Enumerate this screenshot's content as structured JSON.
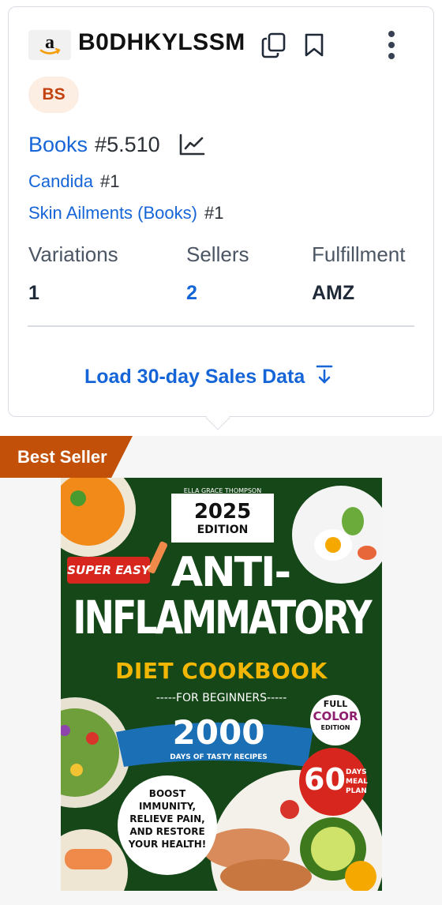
{
  "header": {
    "logo_icon": "amazon-logo-icon",
    "asin": "B0DHKYLSSM",
    "actions": [
      "copy-icon",
      "bookmark-icon",
      "more-vertical-icon"
    ]
  },
  "badge": {
    "label": "BS"
  },
  "rank": {
    "main": {
      "category": "Books",
      "rank": "#5.510",
      "icon": "line-chart-icon"
    },
    "sub": [
      {
        "category": "Candida",
        "rank": "#1"
      },
      {
        "category": "Skin Ailments (Books)",
        "rank": "#1"
      }
    ]
  },
  "stats": [
    {
      "label": "Variations",
      "value": "1"
    },
    {
      "label": "Sellers",
      "value": "2"
    },
    {
      "label": "Fulfillment",
      "value": "AMZ"
    }
  ],
  "load_sales": {
    "label": "Load 30-day Sales Data",
    "icon": "arrow-down-to-line-icon"
  },
  "product": {
    "ribbon": "Best Seller",
    "cover": {
      "author": "ELLA GRACE THOMPSON",
      "year": "2025",
      "edition": "EDITION",
      "tag": "SUPER EASY",
      "title_1": "ANTI-",
      "title_2": "INFLAMMATORY",
      "title_3": "DIET COOKBOOK",
      "subtitle": "-----FOR BEGINNERS-----",
      "big_number": "2000",
      "big_number_caption": "DAYS OF TASTY RECIPES",
      "color_1": "FULL",
      "color_2": "COLOR",
      "color_3": "EDITION",
      "meal_number": "60",
      "meal_1": "DAYS",
      "meal_2": "MEAL",
      "meal_3": "PLAN",
      "promo_1": "BOOST",
      "promo_2": "IMMUNITY,",
      "promo_3": "RELIEVE PAIN,",
      "promo_4": "AND RESTORE",
      "promo_5": "YOUR HEALTH!"
    }
  },
  "colors": {
    "link": "#1565d8",
    "badge_bg": "#fdeee4",
    "badge_text": "#c2410c",
    "ribbon": "#c25008",
    "cover_bg": "#1a4f1c"
  }
}
